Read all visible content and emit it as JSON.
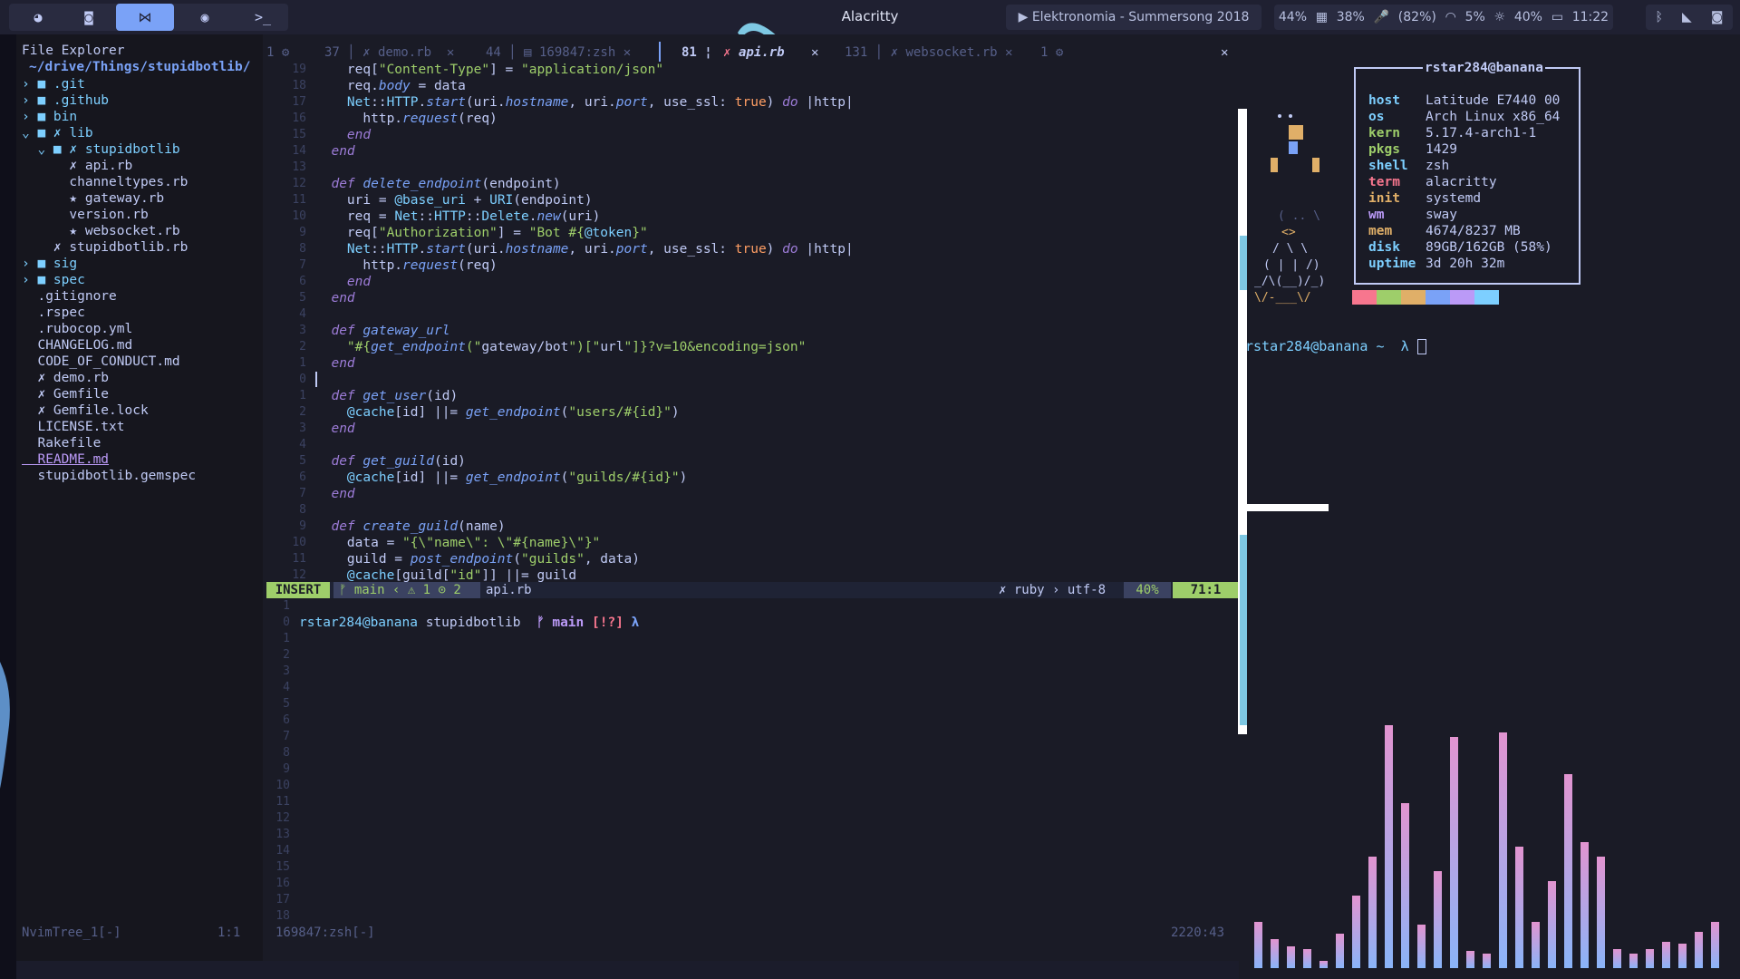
{
  "topbar": {
    "window_title": "Alacritty",
    "workspaces": [
      "firefox-icon",
      "discord-icon",
      "vscode-icon",
      "spotify-icon",
      "terminal-icon"
    ],
    "media": "▶ Elektronomia - Summersong 2018",
    "stats": {
      "cpu": "44%",
      "gpu": "38%",
      "mic": "(82%)",
      "net": "5%",
      "brightness": "",
      "battery": "40%"
    },
    "clock": "11:22"
  },
  "filetree": {
    "title": "File Explorer",
    "root": "~/drive/Things/stupidbotlib/",
    "items": [
      {
        "label": "› ■ .git",
        "color": "#7dcfff"
      },
      {
        "label": "› ■ .github",
        "color": "#7dcfff"
      },
      {
        "label": "› ■ bin",
        "color": "#7dcfff"
      },
      {
        "label": "⌄ ■ ✗ lib",
        "color": "#7dcfff"
      },
      {
        "label": "  ⌄ ■ ✗ stupidbotlib",
        "color": "#7dcfff"
      },
      {
        "label": "      ✗ api.rb",
        "color": "#c0caf5"
      },
      {
        "label": "      channeltypes.rb",
        "color": "#c0caf5"
      },
      {
        "label": "      ★ gateway.rb",
        "color": "#c0caf5"
      },
      {
        "label": "      version.rb",
        "color": "#c0caf5"
      },
      {
        "label": "      ★ websocket.rb",
        "color": "#c0caf5"
      },
      {
        "label": "    ✗ stupidbotlib.rb",
        "color": "#c0caf5"
      },
      {
        "label": "› ■ sig",
        "color": "#7dcfff"
      },
      {
        "label": "› ■ spec",
        "color": "#7dcfff"
      },
      {
        "label": "  .gitignore",
        "color": "#c0caf5"
      },
      {
        "label": "  .rspec",
        "color": "#c0caf5"
      },
      {
        "label": "  .rubocop.yml",
        "color": "#c0caf5"
      },
      {
        "label": "  CHANGELOG.md",
        "color": "#c0caf5"
      },
      {
        "label": "  CODE_OF_CONDUCT.md",
        "color": "#c0caf5"
      },
      {
        "label": "  ✗ demo.rb",
        "color": "#c0caf5"
      },
      {
        "label": "  ✗ Gemfile",
        "color": "#c0caf5"
      },
      {
        "label": "  ✗ Gemfile.lock",
        "color": "#c0caf5"
      },
      {
        "label": "  LICENSE.txt",
        "color": "#c0caf5"
      },
      {
        "label": "  Rakefile",
        "color": "#c0caf5"
      },
      {
        "label": "  README.md",
        "color": "#bb9af7"
      },
      {
        "label": "  stupidbotlib.gemspec",
        "color": "#c0caf5"
      }
    ],
    "status_left": "NvimTree_1[-]",
    "status_right": "1:1"
  },
  "tabs": {
    "t1": "1 ⚙",
    "t2": "37 │ ✗ demo.rb  ✕",
    "t3": "44 │ ▤ 169847:zsh ✕",
    "t4": "81 ¦",
    "t4_file": "api.rb",
    "t5": "131 │ ✗ websocket.rb ✕",
    "t6": "1 ⚙",
    "close": "✕"
  },
  "code": {
    "line_numbers": [
      "19",
      "18",
      "17",
      "16",
      "15",
      "14",
      "13",
      "12",
      "11",
      "10",
      "9",
      "8",
      "7",
      "6",
      "5",
      "4",
      "3",
      "2",
      "1",
      "0",
      "1",
      "2",
      "3",
      "4",
      "5",
      "6",
      "7",
      "8",
      "9",
      "10",
      "11",
      "12"
    ],
    "lines": [
      "    req[\"Content-Type\"] = \"application/json\"",
      "    req.body = data",
      "    Net::HTTP.start(uri.hostname, uri.port, use_ssl: true) do |http|",
      "      http.request(req)",
      "    end",
      "  end",
      "",
      "  def delete_endpoint(endpoint)",
      "    uri = @base_uri + URI(endpoint)",
      "    req = Net::HTTP::Delete.new(uri)",
      "    req[\"Authorization\"] = \"Bot #{@token}\"",
      "    Net::HTTP.start(uri.hostname, uri.port, use_ssl: true) do |http|",
      "      http.request(req)",
      "    end",
      "  end",
      "",
      "  def gateway_url",
      "    \"#{get_endpoint(\"gateway/bot\")[\"url\"]}?v=10&encoding=json\"",
      "  end",
      "",
      "  def get_user(id)",
      "    @cache[id] ||= get_endpoint(\"users/#{id}\")",
      "  end",
      "",
      "  def get_guild(id)",
      "    @cache[id] ||= get_endpoint(\"guilds/#{id}\")",
      "  end",
      "",
      "  def create_guild(name)",
      "    data = \"{\\\"name\\\": \\\"#{name}\\\"}\"",
      "    guild = post_endpoint(\"guilds\", data)",
      "    @cache[guild[\"id\"]] ||= guild"
    ]
  },
  "statusline": {
    "mode": "INSERT",
    "branch": "ᚠ main ‹ ⚠ 1 ⊙ 2",
    "file": "api.rb",
    "filetype": "✗ ruby › utf-8",
    "percent": "40%",
    "position": "71:1"
  },
  "terminal": {
    "line_numbers": [
      "1",
      "0",
      "1",
      "2",
      "3",
      "4",
      "5",
      "6",
      "7",
      "8",
      "9",
      "10",
      "11",
      "12",
      "13",
      "14",
      "15",
      "16",
      "17",
      "18"
    ],
    "prompt_user": "rstar284@banana",
    "prompt_dir": "stupidbotlib",
    "prompt_branch": "ᚠ main",
    "prompt_status": "[!?]",
    "prompt_symbol": "λ",
    "status_left": "169847:zsh[-]",
    "status_right": "2220:43"
  },
  "fetch": {
    "title": "rstar284@banana",
    "rows": [
      {
        "key": "host",
        "value": "Latitude E7440 00",
        "color": "#7dcfff"
      },
      {
        "key": "os",
        "value": "Arch Linux x86_64",
        "color": "#7dcfff"
      },
      {
        "key": "kern",
        "value": "5.17.4-arch1-1",
        "color": "#9ece6a"
      },
      {
        "key": "pkgs",
        "value": "1429",
        "color": "#9ece6a"
      },
      {
        "key": "shell",
        "value": "zsh",
        "color": "#7dcfff"
      },
      {
        "key": "term",
        "value": "alacritty",
        "color": "#f7768e"
      },
      {
        "key": "init",
        "value": "systemd",
        "color": "#e0af68"
      },
      {
        "key": "wm",
        "value": "sway",
        "color": "#bb9af7"
      },
      {
        "key": "mem",
        "value": "4674/8237 MB",
        "color": "#e0af68"
      },
      {
        "key": "disk",
        "value": "89GB/162GB (58%)",
        "color": "#7dcfff"
      },
      {
        "key": "uptime",
        "value": "3d 20h 32m",
        "color": "#7dcfff"
      }
    ],
    "palette": [
      "#f7768e",
      "#9ece6a",
      "#e0af68",
      "#7aa2f7",
      "#bb9af7",
      "#7dcfff"
    ],
    "prompt": "rstar284@banana ~  λ"
  },
  "visualizer": {
    "levels": [
      0.19,
      0.12,
      0.09,
      0.08,
      0.03,
      0.14,
      0.3,
      0.46,
      1.0,
      0.68,
      0.18,
      0.4,
      0.95,
      0.07,
      0.06,
      0.97,
      0.5,
      0.19,
      0.36,
      0.8,
      0.52,
      0.46,
      0.08,
      0.06,
      0.08,
      0.11,
      0.1,
      0.15,
      0.19
    ]
  }
}
